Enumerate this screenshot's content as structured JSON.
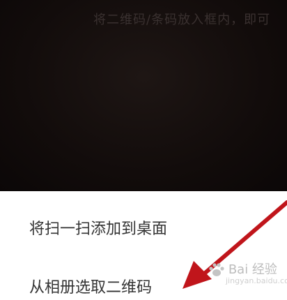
{
  "scanner": {
    "hint_text": "将二维码/条码放入框内，即可"
  },
  "menu": {
    "add_to_desktop": "将扫一扫添加到桌面",
    "select_from_album": "从相册选取二维码"
  },
  "watermark": {
    "logo_text": "Bai 经验",
    "site": "jingyan.baidu.com"
  },
  "colors": {
    "camera_background": "#120c0b",
    "sheet_background": "#ffffff",
    "menu_text": "#333333",
    "annotation_arrow": "#c0151b"
  }
}
